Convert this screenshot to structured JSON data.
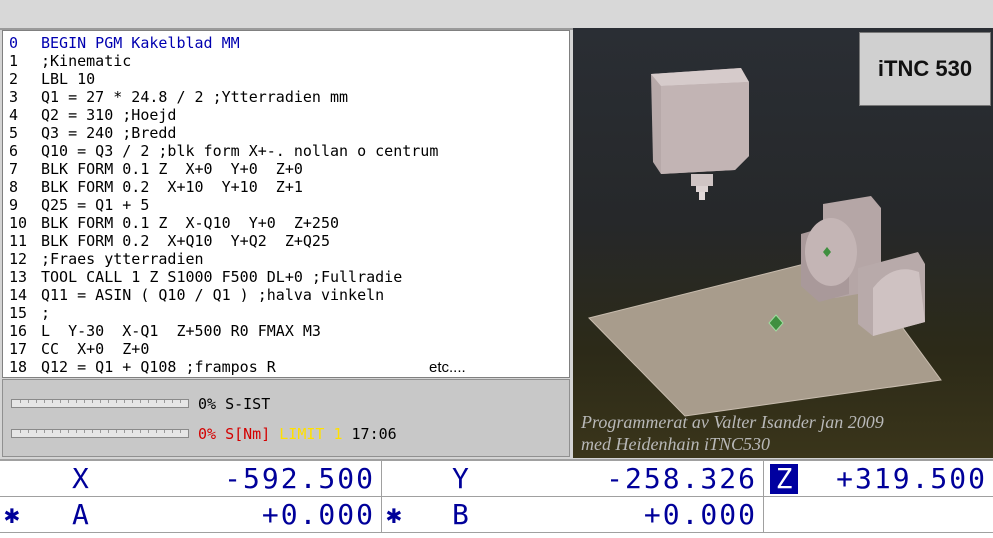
{
  "program": {
    "lines": [
      {
        "num": "0",
        "text": "BEGIN PGM Kakelblad MM"
      },
      {
        "num": "1",
        "text": ";Kinematic"
      },
      {
        "num": "2",
        "text": "LBL 10"
      },
      {
        "num": "3",
        "text": "Q1 = 27 * 24.8 / 2 ;Ytterradien mm"
      },
      {
        "num": "4",
        "text": "Q2 = 310 ;Hoejd"
      },
      {
        "num": "5",
        "text": "Q3 = 240 ;Bredd"
      },
      {
        "num": "6",
        "text": "Q10 = Q3 / 2 ;blk form X+-. nollan o centrum"
      },
      {
        "num": "7",
        "text": "BLK FORM 0.1 Z  X+0  Y+0  Z+0"
      },
      {
        "num": "8",
        "text": "BLK FORM 0.2  X+10  Y+10  Z+1"
      },
      {
        "num": "9",
        "text": "Q25 = Q1 + 5"
      },
      {
        "num": "10",
        "text": "BLK FORM 0.1 Z  X-Q10  Y+0  Z+250"
      },
      {
        "num": "11",
        "text": "BLK FORM 0.2  X+Q10  Y+Q2  Z+Q25"
      },
      {
        "num": "12",
        "text": ";Fraes ytterradien"
      },
      {
        "num": "13",
        "text": "TOOL CALL 1 Z S1000 F500 DL+0 ;Fullradie"
      },
      {
        "num": "14",
        "text": "Q11 = ASIN ( Q10 / Q1 ) ;halva vinkeln"
      },
      {
        "num": "15",
        "text": ";"
      },
      {
        "num": "16",
        "text": "L  Y-30  X-Q1  Z+500 R0 FMAX M3"
      },
      {
        "num": "17",
        "text": "CC  X+0  Z+0"
      },
      {
        "num": "18",
        "text": "Q12 = Q1 + Q108 ;frampos R"
      }
    ],
    "etc": "etc...."
  },
  "status": {
    "s_ist_pct": "0%",
    "s_ist_label": "S-IST",
    "s_nm_pct": "0%",
    "s_nm_label": "S[Nm]",
    "limit_label": "LIMIT",
    "limit_value": "1",
    "time": "17:06"
  },
  "view": {
    "brand": "iTNC 530",
    "credit_line1": "Programmerat av Valter Isander jan 2009",
    "credit_line2": "med Heidenhain iTNC530"
  },
  "positions": {
    "x_label": "X",
    "x_value": "-592.500",
    "y_label": "Y",
    "y_value": "-258.326",
    "z_label": "Z",
    "z_value": "+319.500",
    "a_label": "A",
    "a_value": "+0.000",
    "b_label": "B",
    "b_value": "+0.000",
    "star_symbol": "✱"
  },
  "colors": {
    "program_first_line": "#0000b0",
    "position_text": "#00009a",
    "selected_axis_bg": "#0000a0",
    "warning_red": "#d40000",
    "limit_yellow": "#ffe000"
  }
}
